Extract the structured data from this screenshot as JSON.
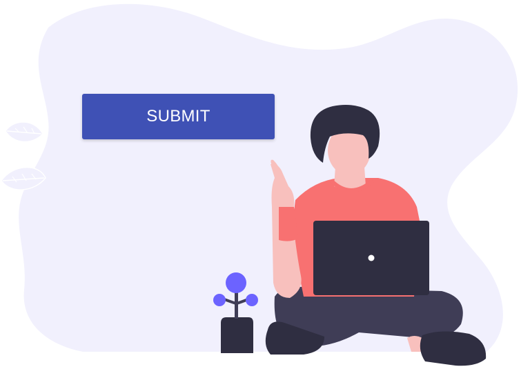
{
  "submit_button": {
    "label": "SUBMIT"
  },
  "illustration": {
    "description_icon": "person-with-laptop-illustration",
    "colors": {
      "blob": "#f1f0fd",
      "button": "#3f51b5",
      "skin": "#f8c0bd",
      "hair": "#2f2e41",
      "shirt": "#f87171",
      "laptop": "#2f2e41",
      "plant_flower": "#6c63ff",
      "leaf": "#f1f0fd"
    }
  }
}
